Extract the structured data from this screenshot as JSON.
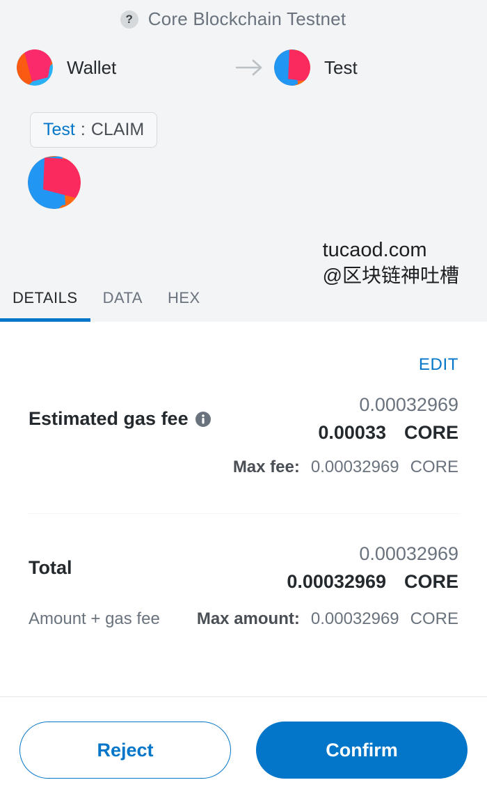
{
  "header": {
    "help_icon": "question-mark-icon",
    "network_name": "Core Blockchain Testnet",
    "arrow_icon": "arrow-right-icon",
    "from_account": {
      "name": "Wallet",
      "icon": "account-identicon"
    },
    "to_account": {
      "name": "Test",
      "icon": "account-identicon"
    },
    "origin": {
      "name": "Test",
      "separator": ":",
      "action": "CLAIM"
    },
    "contract_identicon": "contract-identicon"
  },
  "watermark": {
    "site": "tucaod.com",
    "handle": "@区块链神吐槽"
  },
  "tabs": [
    {
      "label": "DETAILS",
      "active": true
    },
    {
      "label": "DATA",
      "active": false
    },
    {
      "label": "HEX",
      "active": false
    }
  ],
  "details": {
    "edit_label": "EDIT",
    "gas_fee": {
      "label": "Estimated gas fee",
      "info_icon": "info-icon",
      "fiat_value": "0.00032969",
      "amount": "0.00033",
      "currency": "CORE",
      "max_fee_label": "Max fee:",
      "max_fee_value": "0.00032969",
      "max_fee_currency": "CORE"
    },
    "total": {
      "label": "Total",
      "fiat_value": "0.00032969",
      "amount": "0.00032969",
      "currency": "CORE",
      "note": "Amount + gas fee",
      "max_amount_label": "Max amount:",
      "max_amount_value": "0.00032969",
      "max_amount_currency": "CORE"
    }
  },
  "footer": {
    "reject_label": "Reject",
    "confirm_label": "Confirm"
  },
  "colors": {
    "accent": "#0376c9",
    "header_bg": "#f2f4f6",
    "text_primary": "#24292e",
    "text_secondary": "#6a737d"
  }
}
